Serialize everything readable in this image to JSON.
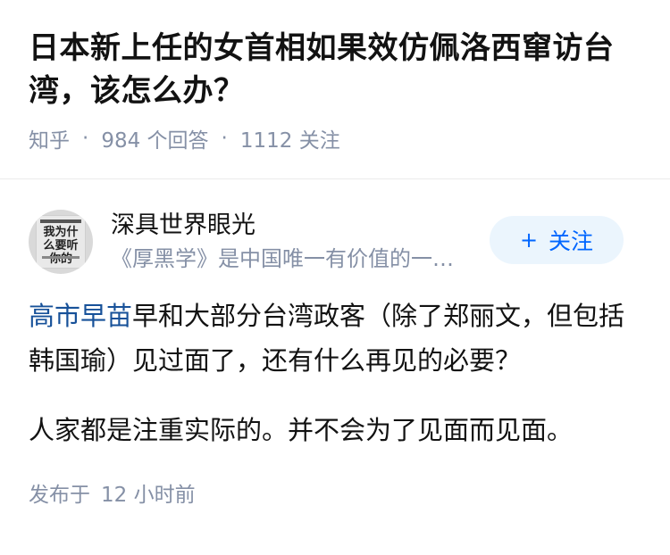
{
  "question": {
    "title": "日本新上任的女首相如果效仿佩洛西窜访台湾，该怎么办？",
    "source": "知乎",
    "answer_count": "984 个回答",
    "follow_count": "1112 关注"
  },
  "answer": {
    "author_name": "深具世界眼光",
    "author_bio": "《厚黑学》是中国唯一有价值的一…",
    "avatar_text": "我为什么要听你的",
    "follow_label": "关注",
    "paragraph1_link": "高市早苗",
    "paragraph1_rest": "早和大部分台湾政客（除了郑丽文，但包括韩国瑜）见过面了，还有什么再见的必要？",
    "paragraph2": "人家都是注重实际的。并不会为了见面而见面。",
    "time_prefix": "发布于",
    "time_value": "12 小时前"
  }
}
